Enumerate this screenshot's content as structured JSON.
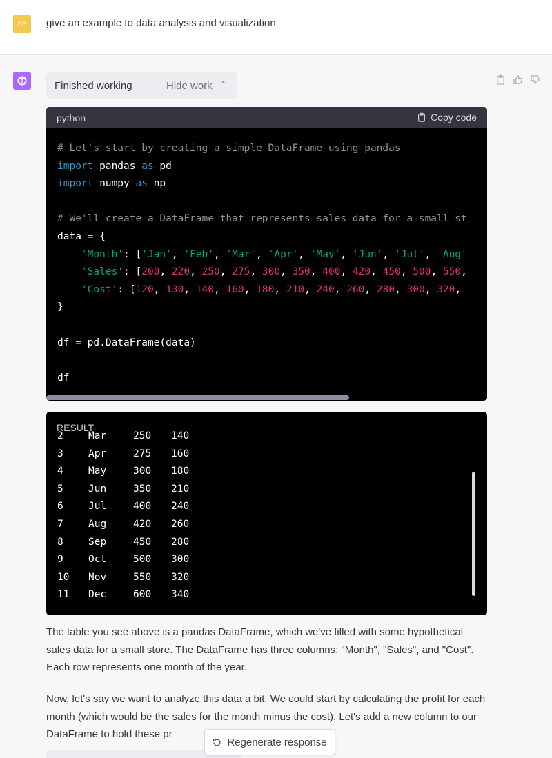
{
  "user": {
    "avatar_initials": "CE",
    "message": "give an example to data analysis and visualization"
  },
  "assistant": {
    "status": "Finished working",
    "toggle_label": "Hide work",
    "actions": [
      "clipboard-icon",
      "thumbs-up-icon",
      "thumbs-down-icon"
    ]
  },
  "code": {
    "language": "python",
    "copy_label": "Copy code",
    "lines": [
      [
        {
          "t": "# Let's start by creating a simple DataFrame using pandas",
          "c": "com"
        }
      ],
      [
        {
          "t": "import",
          "c": "kw"
        },
        {
          "t": " pandas "
        },
        {
          "t": "as",
          "c": "kw"
        },
        {
          "t": " pd"
        }
      ],
      [
        {
          "t": "import",
          "c": "kw"
        },
        {
          "t": " numpy "
        },
        {
          "t": "as",
          "c": "kw"
        },
        {
          "t": " np"
        }
      ],
      [],
      [
        {
          "t": "# We'll create a DataFrame that represents sales data for a small st",
          "c": "com"
        }
      ],
      [
        {
          "t": "data = {"
        }
      ],
      [
        {
          "t": "    "
        },
        {
          "t": "'Month'",
          "c": "str"
        },
        {
          "t": ": ["
        },
        {
          "t": "'Jan'",
          "c": "str"
        },
        {
          "t": ", "
        },
        {
          "t": "'Feb'",
          "c": "str"
        },
        {
          "t": ", "
        },
        {
          "t": "'Mar'",
          "c": "str"
        },
        {
          "t": ", "
        },
        {
          "t": "'Apr'",
          "c": "str"
        },
        {
          "t": ", "
        },
        {
          "t": "'May'",
          "c": "str"
        },
        {
          "t": ", "
        },
        {
          "t": "'Jun'",
          "c": "str"
        },
        {
          "t": ", "
        },
        {
          "t": "'Jul'",
          "c": "str"
        },
        {
          "t": ", "
        },
        {
          "t": "'Aug'",
          "c": "str"
        }
      ],
      [
        {
          "t": "    "
        },
        {
          "t": "'Sales'",
          "c": "str"
        },
        {
          "t": ": ["
        },
        {
          "t": "200",
          "c": "num"
        },
        {
          "t": ", "
        },
        {
          "t": "220",
          "c": "num"
        },
        {
          "t": ", "
        },
        {
          "t": "250",
          "c": "num"
        },
        {
          "t": ", "
        },
        {
          "t": "275",
          "c": "num"
        },
        {
          "t": ", "
        },
        {
          "t": "300",
          "c": "num"
        },
        {
          "t": ", "
        },
        {
          "t": "350",
          "c": "num"
        },
        {
          "t": ", "
        },
        {
          "t": "400",
          "c": "num"
        },
        {
          "t": ", "
        },
        {
          "t": "420",
          "c": "num"
        },
        {
          "t": ", "
        },
        {
          "t": "450",
          "c": "num"
        },
        {
          "t": ", "
        },
        {
          "t": "500",
          "c": "num"
        },
        {
          "t": ", "
        },
        {
          "t": "550",
          "c": "num"
        },
        {
          "t": ","
        }
      ],
      [
        {
          "t": "    "
        },
        {
          "t": "'Cost'",
          "c": "str"
        },
        {
          "t": ": ["
        },
        {
          "t": "120",
          "c": "num"
        },
        {
          "t": ", "
        },
        {
          "t": "130",
          "c": "num"
        },
        {
          "t": ", "
        },
        {
          "t": "140",
          "c": "num"
        },
        {
          "t": ", "
        },
        {
          "t": "160",
          "c": "num"
        },
        {
          "t": ", "
        },
        {
          "t": "180",
          "c": "num"
        },
        {
          "t": ", "
        },
        {
          "t": "210",
          "c": "num"
        },
        {
          "t": ", "
        },
        {
          "t": "240",
          "c": "num"
        },
        {
          "t": ", "
        },
        {
          "t": "260",
          "c": "num"
        },
        {
          "t": ", "
        },
        {
          "t": "280",
          "c": "num"
        },
        {
          "t": ", "
        },
        {
          "t": "300",
          "c": "num"
        },
        {
          "t": ", "
        },
        {
          "t": "320",
          "c": "num"
        },
        {
          "t": ","
        }
      ],
      [
        {
          "t": "}"
        }
      ],
      [],
      [
        {
          "t": "df = pd.DataFrame(data)"
        }
      ],
      [],
      [
        {
          "t": "df"
        }
      ]
    ]
  },
  "result": {
    "label": "RESULT",
    "rows": [
      [
        "2",
        "Mar",
        "250",
        "140"
      ],
      [
        "3",
        "Apr",
        "275",
        "160"
      ],
      [
        "4",
        "May",
        "300",
        "180"
      ],
      [
        "5",
        "Jun",
        "350",
        "210"
      ],
      [
        "6",
        "Jul",
        "400",
        "240"
      ],
      [
        "7",
        "Aug",
        "420",
        "260"
      ],
      [
        "8",
        "Sep",
        "450",
        "280"
      ],
      [
        "9",
        "Oct",
        "500",
        "300"
      ],
      [
        "10",
        "Nov",
        "550",
        "320"
      ],
      [
        "11",
        "Dec",
        "600",
        "340"
      ]
    ]
  },
  "paragraphs": [
    "The table you see above is a pandas DataFrame, which we've filled with some hypothetical sales data for a small store. The DataFrame has three columns: \"Month\", \"Sales\", and \"Cost\". Each row represents one month of the year.",
    "Now, let's say we want to analyze this data a bit. We could start by calculating the profit for each month (which would be the sales for the month minus the cost). Let's add a new column to our DataFrame to hold these pr"
  ],
  "regenerate_label": "Regenerate response"
}
